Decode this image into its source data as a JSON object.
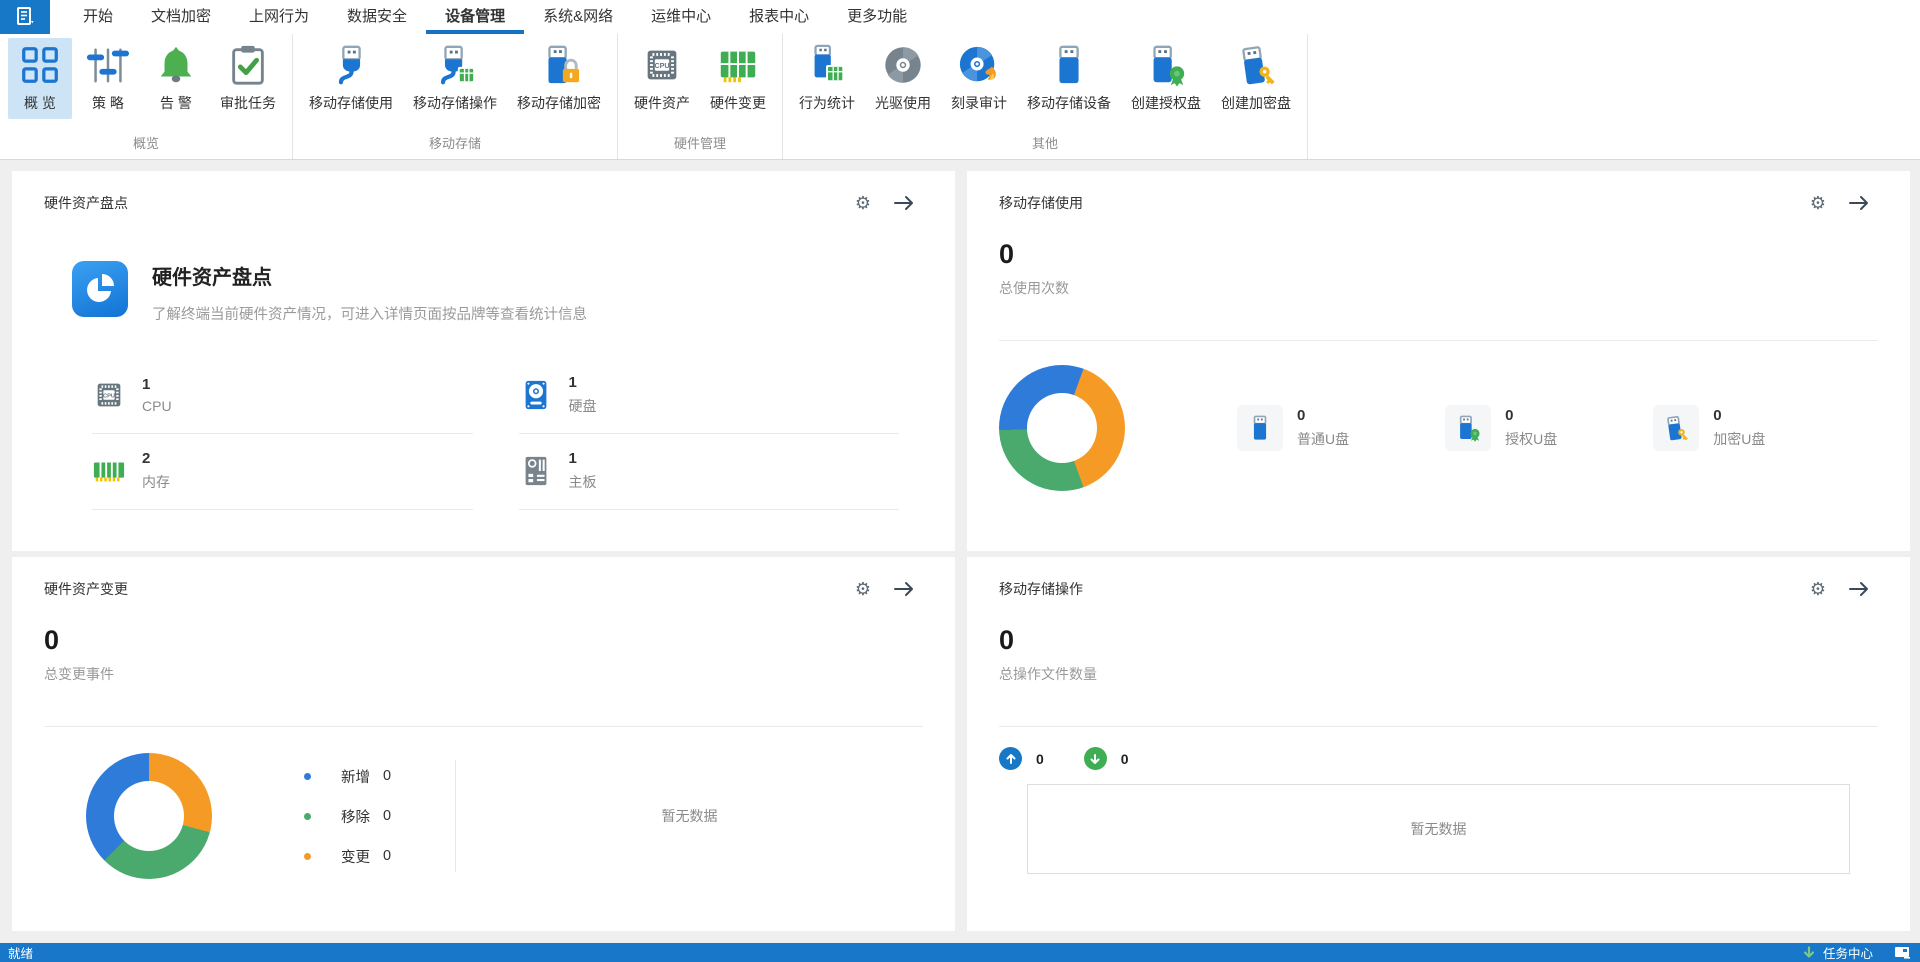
{
  "menu": {
    "app_button": {
      "name": "应用菜单"
    },
    "tabs": [
      {
        "label": "开始",
        "active": false
      },
      {
        "label": "文档加密",
        "active": false
      },
      {
        "label": "上网行为",
        "active": false
      },
      {
        "label": "数据安全",
        "active": false
      },
      {
        "label": "设备管理",
        "active": true
      },
      {
        "label": "系统&网络",
        "active": false
      },
      {
        "label": "运维中心",
        "active": false
      },
      {
        "label": "报表中心",
        "active": false
      },
      {
        "label": "更多功能",
        "active": false
      }
    ]
  },
  "ribbon": {
    "groups": [
      {
        "label": "概览",
        "items": [
          {
            "label": "概 览",
            "icon": "overview-grid",
            "selected": true
          },
          {
            "label": "策 略",
            "icon": "policy-sliders",
            "selected": false
          },
          {
            "label": "告 警",
            "icon": "alert-bell",
            "selected": false
          },
          {
            "label": "审批任务",
            "icon": "approval-clipboard",
            "selected": false
          }
        ]
      },
      {
        "label": "移动存储",
        "items": [
          {
            "label": "移动存储使用",
            "icon": "usb-plug"
          },
          {
            "label": "移动存储操作",
            "icon": "usb-plug-table"
          },
          {
            "label": "移动存储加密",
            "icon": "usb-lock"
          }
        ]
      },
      {
        "label": "硬件管理",
        "items": [
          {
            "label": "硬件资产",
            "icon": "cpu-chip"
          },
          {
            "label": "硬件变更",
            "icon": "ram-board"
          }
        ]
      },
      {
        "label": "其他",
        "items": [
          {
            "label": "行为统计",
            "icon": "usb-table"
          },
          {
            "label": "光驱使用",
            "icon": "cd-disc"
          },
          {
            "label": "刻录审计",
            "icon": "cd-burn"
          },
          {
            "label": "移动存储设备",
            "icon": "usb-stick"
          },
          {
            "label": "创建授权盘",
            "icon": "usb-badge"
          },
          {
            "label": "创建加密盘",
            "icon": "usb-key"
          }
        ]
      }
    ]
  },
  "cards": {
    "hw_inventory": {
      "title": "硬件资产盘点",
      "heading": "硬件资产盘点",
      "description": "了解终端当前硬件资产情况，可进入详情页面按品牌等查看统计信息",
      "stats": [
        {
          "value": "1",
          "label": "CPU",
          "icon": "cpu"
        },
        {
          "value": "1",
          "label": "硬盘",
          "icon": "hdd"
        },
        {
          "value": "2",
          "label": "内存",
          "icon": "ram"
        },
        {
          "value": "1",
          "label": "主板",
          "icon": "motherboard"
        }
      ]
    },
    "storage_usage": {
      "title": "移动存储使用",
      "total_value": "0",
      "total_label": "总使用次数",
      "donut": [
        {
          "color": "#2f7bd9",
          "from": 0,
          "to": 20
        },
        {
          "color": "#f59b25",
          "from": 20,
          "to": 160
        },
        {
          "color": "#4aa96c",
          "from": 160,
          "to": 268
        },
        {
          "color": "#2f7bd9",
          "from": 268,
          "to": 360
        }
      ],
      "items": [
        {
          "value": "0",
          "label": "普通U盘",
          "icon": "usb-plain"
        },
        {
          "value": "0",
          "label": "授权U盘",
          "icon": "usb-badge"
        },
        {
          "value": "0",
          "label": "加密U盘",
          "icon": "usb-key"
        }
      ]
    },
    "hw_change": {
      "title": "硬件资产变更",
      "total_value": "0",
      "total_label": "总变更事件",
      "donut": [
        {
          "color": "#f59b25",
          "from": 0,
          "to": 105
        },
        {
          "color": "#4aa96c",
          "from": 105,
          "to": 225
        },
        {
          "color": "#2f7bd9",
          "from": 225,
          "to": 360
        }
      ],
      "legend": [
        {
          "label": "新增",
          "value": "0",
          "color": "#2f7bd9"
        },
        {
          "label": "移除",
          "value": "0",
          "color": "#4aa96c"
        },
        {
          "label": "变更",
          "value": "0",
          "color": "#f59b25"
        }
      ],
      "empty_text": "暂无数据"
    },
    "storage_ops": {
      "title": "移动存储操作",
      "total_value": "0",
      "total_label": "总操作文件数量",
      "in_value": "0",
      "out_value": "0",
      "empty_text": "暂无数据"
    }
  },
  "status_bar": {
    "ready": "就绪",
    "task_center": "任务中心"
  },
  "colors": {
    "accent": "#1778c8",
    "icon_blue": "#1c76d1",
    "green": "#3fae53",
    "orange": "#f59b25",
    "donut_blue": "#2f7bd9",
    "donut_green": "#4aa96c",
    "selected_tile": "#cde3f6"
  },
  "chart_data": [
    {
      "type": "pie",
      "title": "移动存储使用",
      "categories": [
        "普通U盘",
        "授权U盘",
        "加密U盘"
      ],
      "values": [
        0,
        0,
        0
      ],
      "note": "placeholder donut, all values zero"
    },
    {
      "type": "pie",
      "title": "硬件资产变更",
      "categories": [
        "新增",
        "移除",
        "变更"
      ],
      "values": [
        0,
        0,
        0
      ],
      "note": "placeholder donut, all values zero"
    }
  ]
}
